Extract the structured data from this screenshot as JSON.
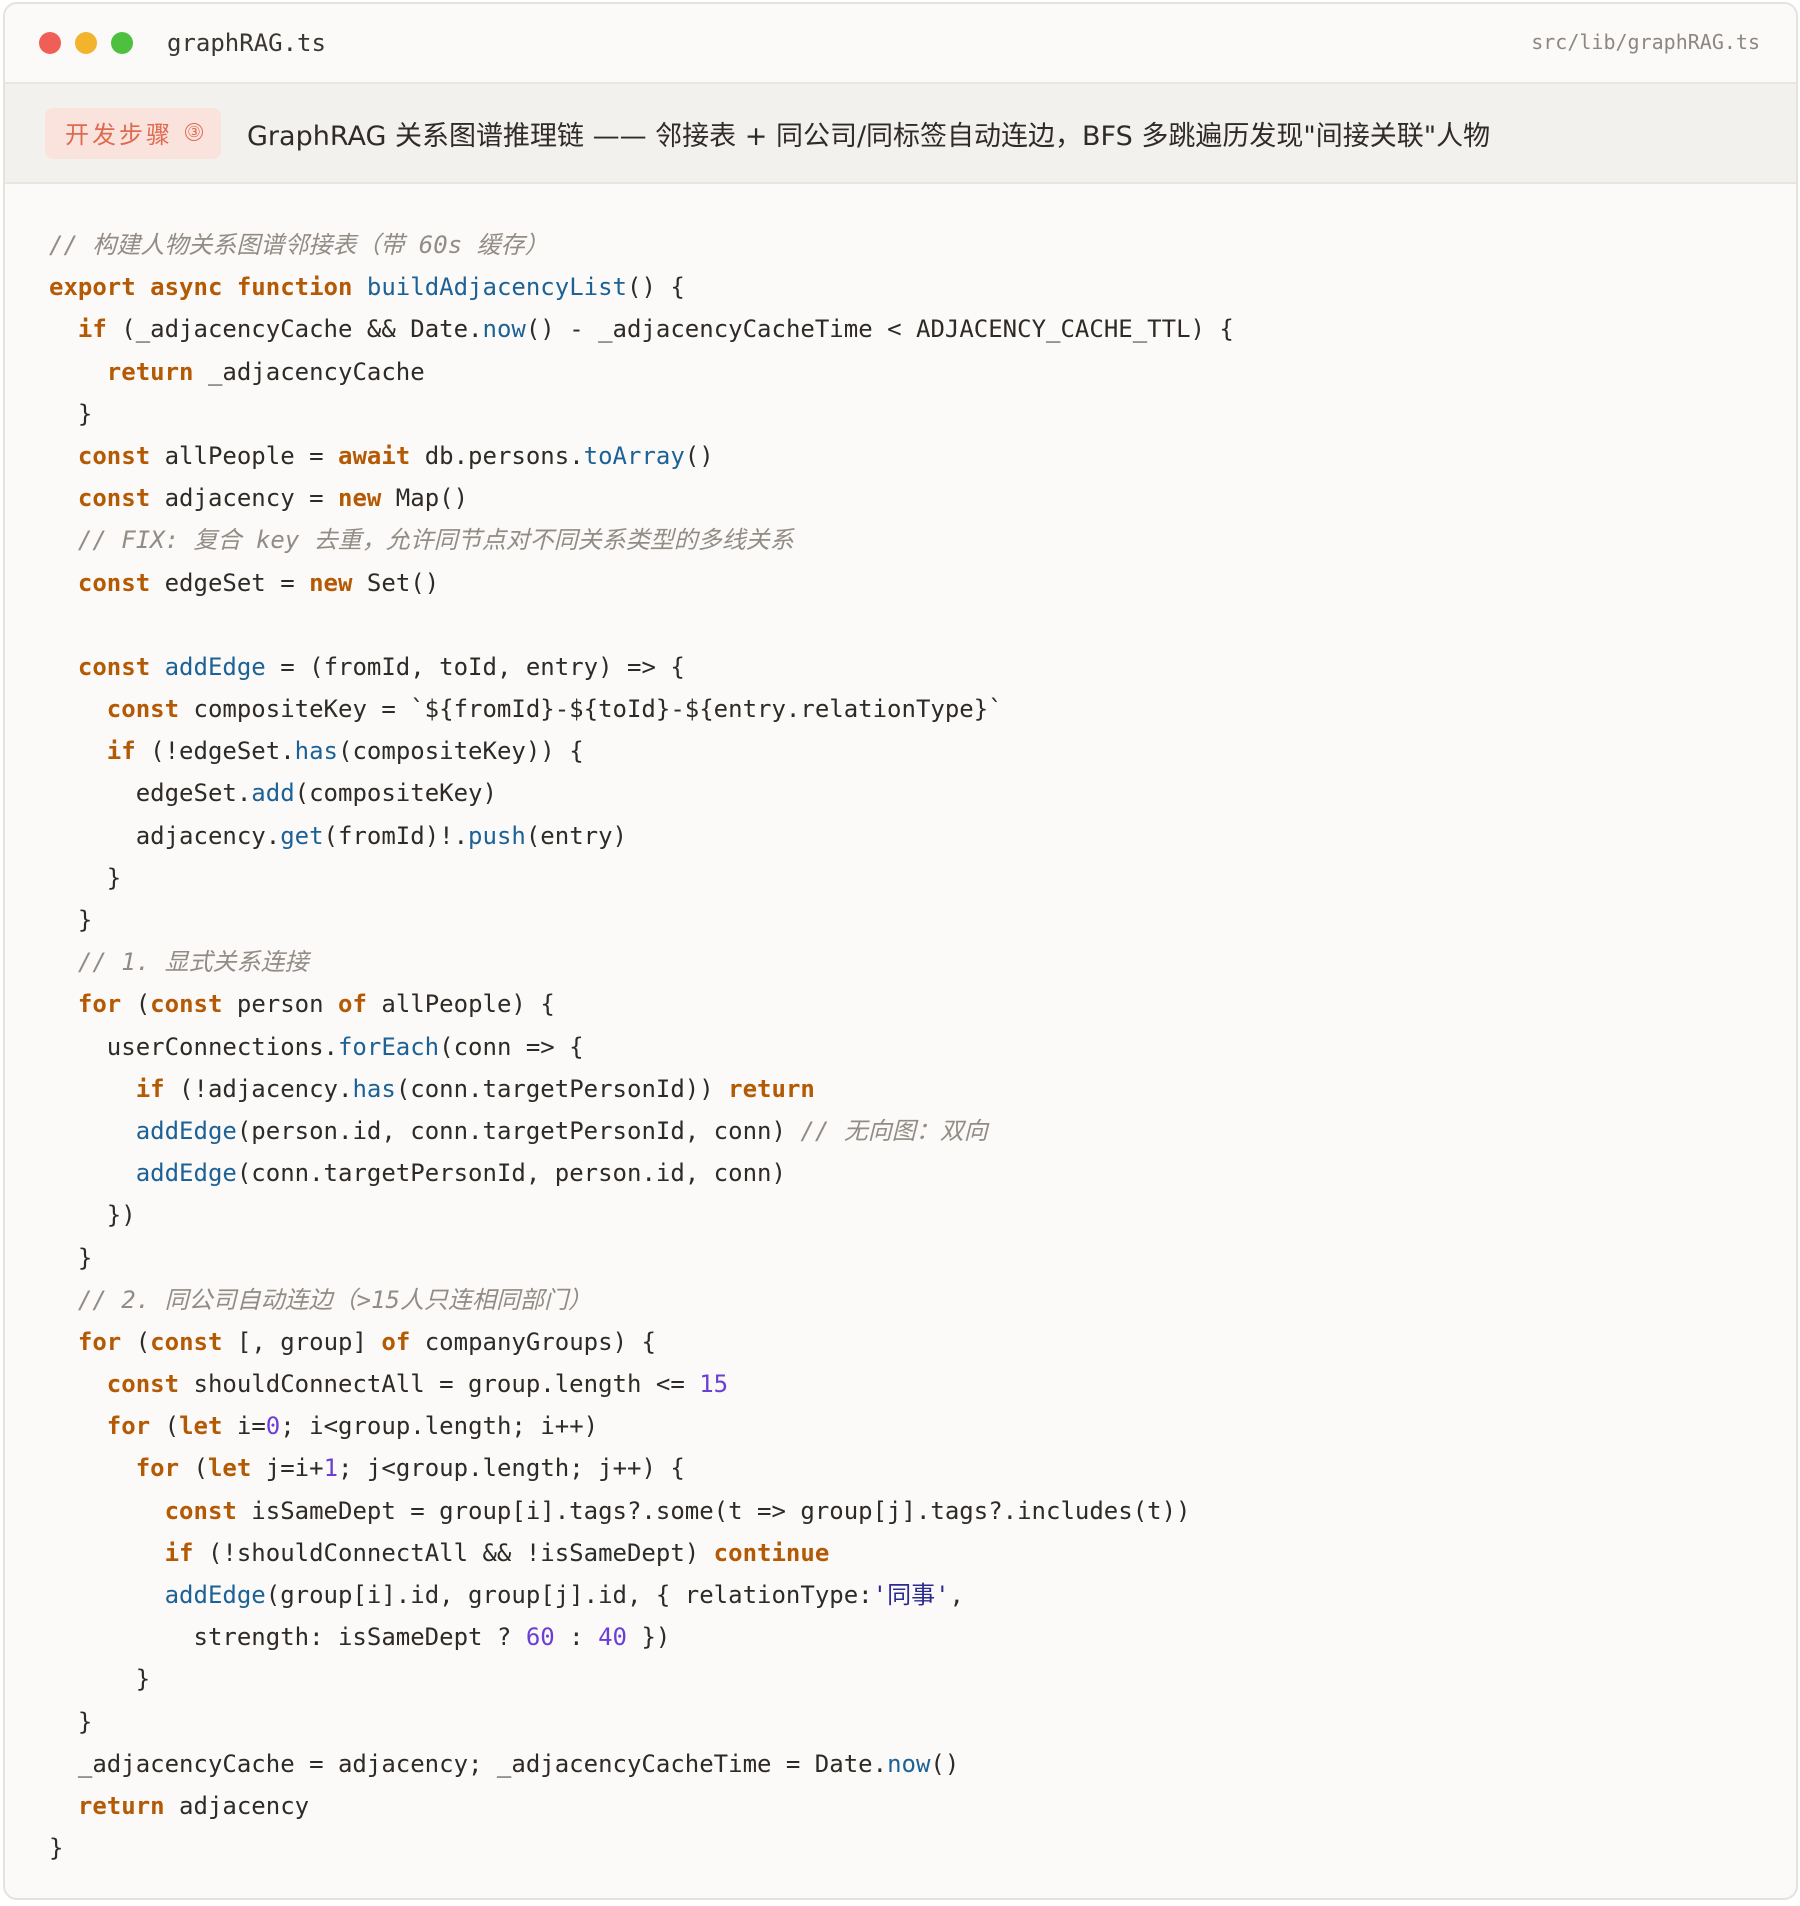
{
  "window": {
    "filename": "graphRAG.ts",
    "filepath": "src/lib/graphRAG.ts"
  },
  "header": {
    "badge_label": "开发步骤",
    "badge_number": "③",
    "title": "GraphRAG 关系图谱推理链 —— 邻接表 + 同公司/同标签自动连边，BFS 多跳遍历发现\"间接关联\"人物"
  },
  "colors": {
    "keyword": "#b45a04",
    "function": "#1d6296",
    "number": "#6b3fd6",
    "comment": "#938c86",
    "badge_bg": "#fbe3dd",
    "badge_text": "#de6b50"
  },
  "code_lines": [
    [
      [
        "c",
        "// 构建人物关系图谱邻接表（带 60s 缓存）"
      ]
    ],
    [
      [
        "k",
        "export"
      ],
      [
        "",
        " "
      ],
      [
        "k",
        "async"
      ],
      [
        "",
        " "
      ],
      [
        "k",
        "function"
      ],
      [
        "",
        " "
      ],
      [
        "f",
        "buildAdjacencyList"
      ],
      [
        "",
        "() {"
      ]
    ],
    [
      [
        "",
        "  "
      ],
      [
        "k",
        "if"
      ],
      [
        "",
        " (_adjacencyCache && Date."
      ],
      [
        "f",
        "now"
      ],
      [
        "",
        "() - _adjacencyCacheTime < ADJACENCY_CACHE_TTL) {"
      ]
    ],
    [
      [
        "",
        "    "
      ],
      [
        "k",
        "return"
      ],
      [
        "",
        " _adjacencyCache"
      ]
    ],
    [
      [
        "",
        "  }"
      ]
    ],
    [
      [
        "",
        "  "
      ],
      [
        "k",
        "const"
      ],
      [
        "",
        " allPeople = "
      ],
      [
        "k",
        "await"
      ],
      [
        "",
        " db.persons."
      ],
      [
        "f",
        "toArray"
      ],
      [
        "",
        "()"
      ]
    ],
    [
      [
        "",
        "  "
      ],
      [
        "k",
        "const"
      ],
      [
        "",
        " adjacency = "
      ],
      [
        "k",
        "new"
      ],
      [
        "",
        " Map()"
      ]
    ],
    [
      [
        "",
        "  "
      ],
      [
        "c",
        "// FIX: 复合 key 去重，允许同节点对不同关系类型的多线关系"
      ]
    ],
    [
      [
        "",
        "  "
      ],
      [
        "k",
        "const"
      ],
      [
        "",
        " edgeSet = "
      ],
      [
        "k",
        "new"
      ],
      [
        "",
        " Set()"
      ]
    ],
    [
      [
        "",
        ""
      ]
    ],
    [
      [
        "",
        "  "
      ],
      [
        "k",
        "const"
      ],
      [
        "",
        " "
      ],
      [
        "f",
        "addEdge"
      ],
      [
        "",
        " = (fromId, toId, entry) => {"
      ]
    ],
    [
      [
        "",
        "    "
      ],
      [
        "k",
        "const"
      ],
      [
        "",
        " compositeKey = `${fromId}-${toId}-${entry.relationType}`"
      ]
    ],
    [
      [
        "",
        "    "
      ],
      [
        "k",
        "if"
      ],
      [
        "",
        " (!edgeSet."
      ],
      [
        "f",
        "has"
      ],
      [
        "",
        "(compositeKey)) {"
      ]
    ],
    [
      [
        "",
        "      edgeSet."
      ],
      [
        "f",
        "add"
      ],
      [
        "",
        "(compositeKey)"
      ]
    ],
    [
      [
        "",
        "      adjacency."
      ],
      [
        "f",
        "get"
      ],
      [
        "",
        "(fromId)!."
      ],
      [
        "f",
        "push"
      ],
      [
        "",
        "(entry)"
      ]
    ],
    [
      [
        "",
        "    }"
      ]
    ],
    [
      [
        "",
        "  }"
      ]
    ],
    [
      [
        "",
        "  "
      ],
      [
        "c",
        "// 1. 显式关系连接"
      ]
    ],
    [
      [
        "",
        "  "
      ],
      [
        "k",
        "for"
      ],
      [
        "",
        " ("
      ],
      [
        "k",
        "const"
      ],
      [
        "",
        " person "
      ],
      [
        "k",
        "of"
      ],
      [
        "",
        " allPeople) {"
      ]
    ],
    [
      [
        "",
        "    userConnections."
      ],
      [
        "f",
        "forEach"
      ],
      [
        "",
        "(conn => {"
      ]
    ],
    [
      [
        "",
        "      "
      ],
      [
        "k",
        "if"
      ],
      [
        "",
        " (!adjacency."
      ],
      [
        "f",
        "has"
      ],
      [
        "",
        "(conn.targetPersonId)) "
      ],
      [
        "k",
        "return"
      ]
    ],
    [
      [
        "",
        "      "
      ],
      [
        "f",
        "addEdge"
      ],
      [
        "",
        "(person.id, conn.targetPersonId, conn) "
      ],
      [
        "c",
        "// 无向图：双向"
      ]
    ],
    [
      [
        "",
        "      "
      ],
      [
        "f",
        "addEdge"
      ],
      [
        "",
        "(conn.targetPersonId, person.id, conn)"
      ]
    ],
    [
      [
        "",
        "    })"
      ]
    ],
    [
      [
        "",
        "  }"
      ]
    ],
    [
      [
        "",
        "  "
      ],
      [
        "c",
        "// 2. 同公司自动连边（>15人只连相同部门）"
      ]
    ],
    [
      [
        "",
        "  "
      ],
      [
        "k",
        "for"
      ],
      [
        "",
        " ("
      ],
      [
        "k",
        "const"
      ],
      [
        "",
        " [, group] "
      ],
      [
        "k",
        "of"
      ],
      [
        "",
        " companyGroups) {"
      ]
    ],
    [
      [
        "",
        "    "
      ],
      [
        "k",
        "const"
      ],
      [
        "",
        " shouldConnectAll = group.length <= "
      ],
      [
        "n",
        "15"
      ]
    ],
    [
      [
        "",
        "    "
      ],
      [
        "k",
        "for"
      ],
      [
        "",
        " ("
      ],
      [
        "k",
        "let"
      ],
      [
        "",
        " i="
      ],
      [
        "n",
        "0"
      ],
      [
        "",
        "; i<group.length; i++)"
      ]
    ],
    [
      [
        "",
        "      "
      ],
      [
        "k",
        "for"
      ],
      [
        "",
        " ("
      ],
      [
        "k",
        "let"
      ],
      [
        "",
        " j=i+"
      ],
      [
        "n",
        "1"
      ],
      [
        "",
        "; j<group.length; j++) {"
      ]
    ],
    [
      [
        "",
        "        "
      ],
      [
        "k",
        "const"
      ],
      [
        "",
        " isSameDept = group[i].tags?.some(t => group[j].tags?.includes(t))"
      ]
    ],
    [
      [
        "",
        "        "
      ],
      [
        "k",
        "if"
      ],
      [
        "",
        " (!shouldConnectAll && !isSameDept) "
      ],
      [
        "k",
        "continue"
      ]
    ],
    [
      [
        "",
        "        "
      ],
      [
        "f",
        "addEdge"
      ],
      [
        "",
        "(group[i].id, group[j].id, { relationType:"
      ],
      [
        "s",
        "'同事'"
      ],
      [
        "",
        ","
      ]
    ],
    [
      [
        "",
        "          strength: isSameDept ? "
      ],
      [
        "n",
        "60"
      ],
      [
        "",
        " : "
      ],
      [
        "n",
        "40"
      ],
      [
        "",
        " })"
      ]
    ],
    [
      [
        "",
        "      }"
      ]
    ],
    [
      [
        "",
        "  }"
      ]
    ],
    [
      [
        "",
        "  _adjacencyCache = adjacency; _adjacencyCacheTime = Date."
      ],
      [
        "f",
        "now"
      ],
      [
        "",
        "()"
      ]
    ],
    [
      [
        "",
        "  "
      ],
      [
        "k",
        "return"
      ],
      [
        "",
        " adjacency"
      ]
    ],
    [
      [
        "",
        "}"
      ]
    ]
  ]
}
